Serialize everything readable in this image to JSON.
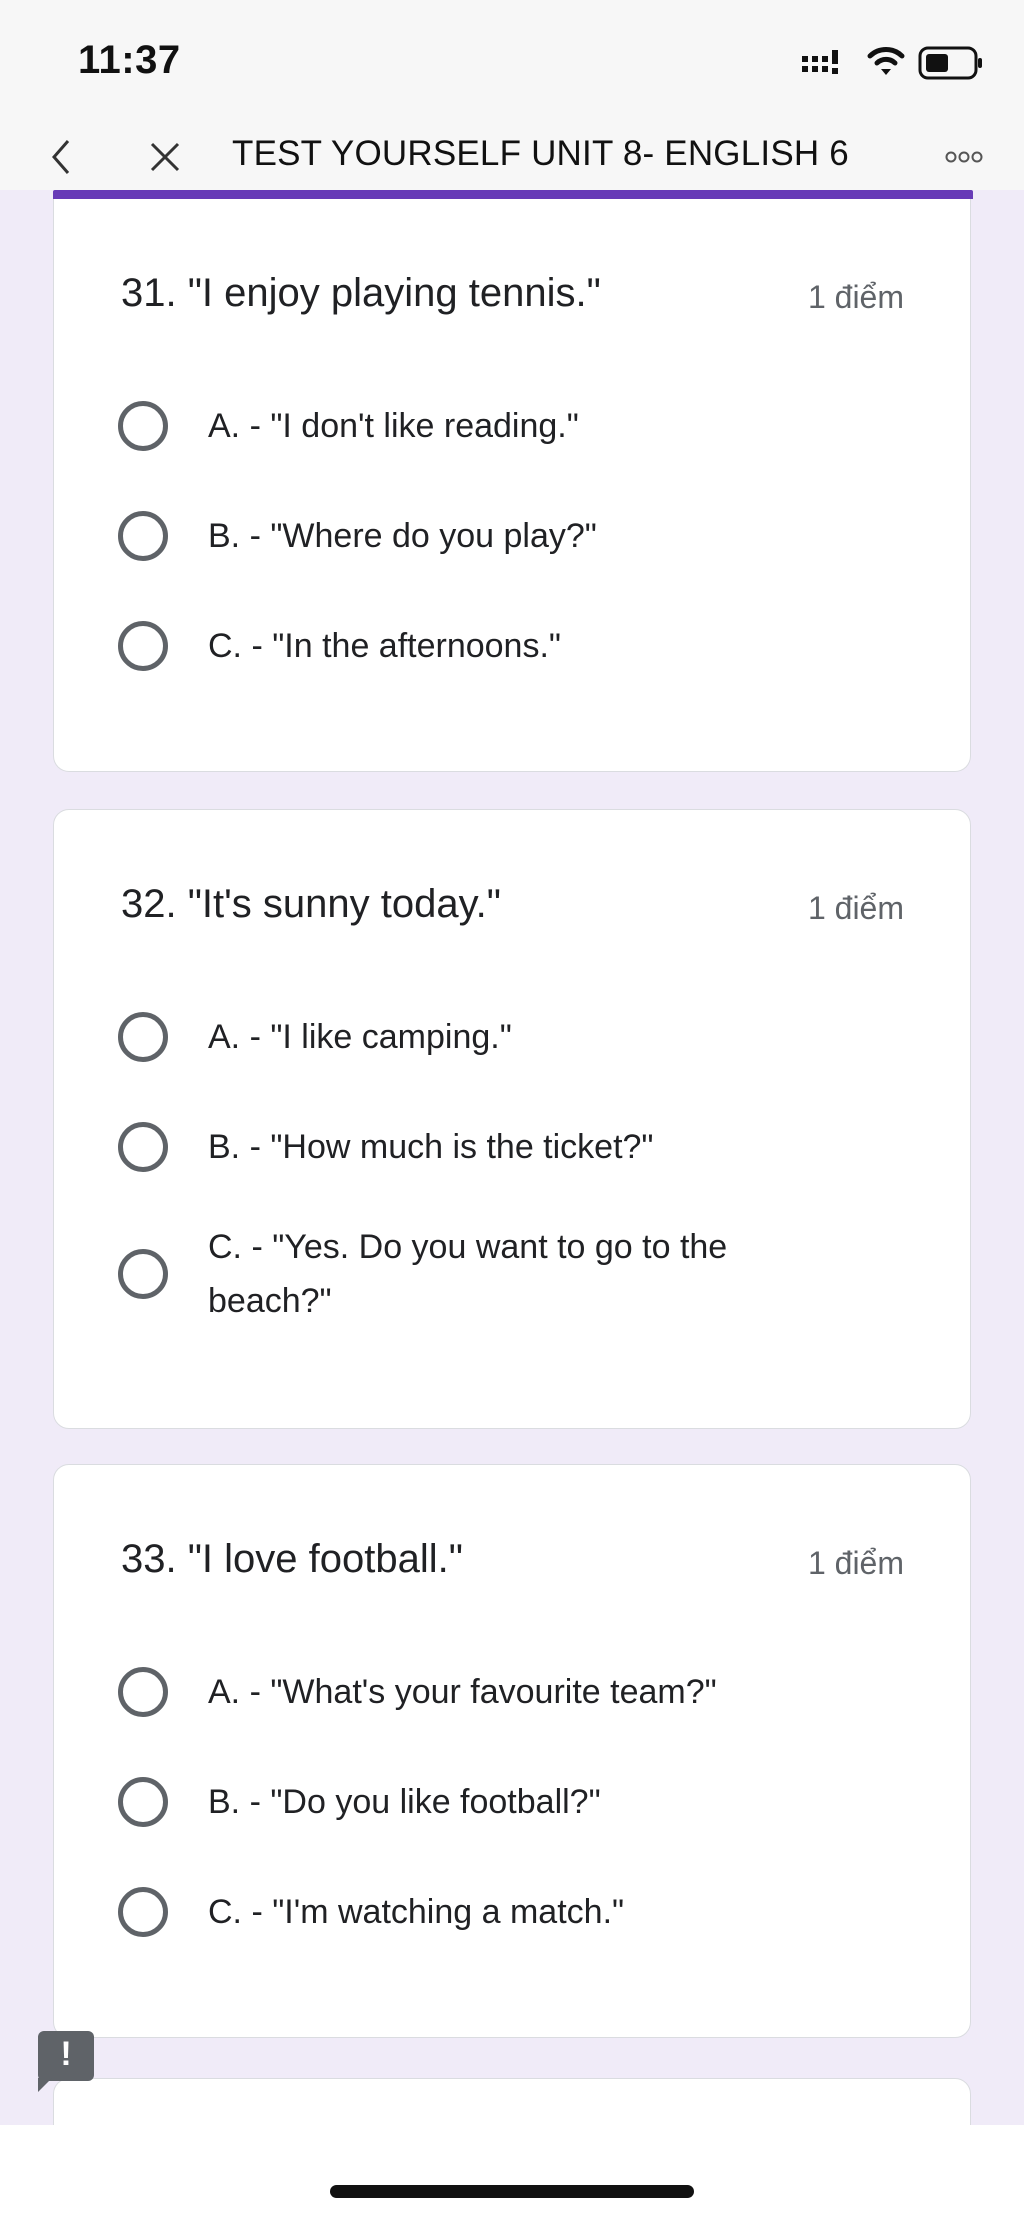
{
  "status_bar": {
    "time": "11:37"
  },
  "nav": {
    "title": "TEST YOURSELF UNIT 8- ENGLISH 6"
  },
  "questions": [
    {
      "title": "31. \"I enjoy playing tennis.\"",
      "points": "1 điểm",
      "options": [
        "A. - \"I don't like reading.\"",
        "B. - \"Where do you play?\"",
        "C. - \"In the afternoons.\""
      ]
    },
    {
      "title": "32. \"It's sunny today.\"",
      "points": "1 điểm",
      "options": [
        "A. - \"I like camping.\"",
        "B. - \"How much is the ticket?\"",
        "C. - \"Yes. Do you want to go to the beach?\""
      ]
    },
    {
      "title": "33. \"I love football.\"",
      "points": "1 điểm",
      "options": [
        "A. - \"What's your favourite team?\"",
        "B. - \"Do you like football?\"",
        "C. - \"I'm watching a match.\""
      ]
    }
  ],
  "feedback": {
    "label": "!"
  },
  "colors": {
    "accent": "#673ab7",
    "background": "#f0ebf8",
    "radio": "#5f6368"
  }
}
